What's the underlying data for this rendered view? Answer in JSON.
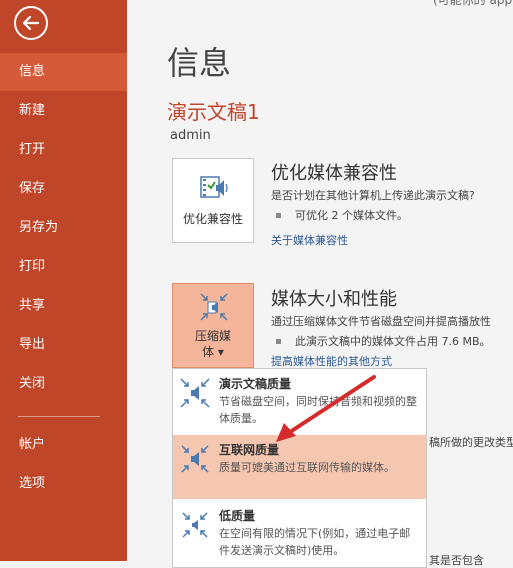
{
  "sidebar": {
    "items": [
      {
        "label": "信息"
      },
      {
        "label": "新建"
      },
      {
        "label": "打开"
      },
      {
        "label": "保存"
      },
      {
        "label": "另存为"
      },
      {
        "label": "打印"
      },
      {
        "label": "共享"
      },
      {
        "label": "导出"
      },
      {
        "label": "关闭"
      },
      {
        "label": "帐户"
      },
      {
        "label": "选项"
      }
    ]
  },
  "header": {
    "top_text": "(可能你的 app",
    "title": "信息",
    "doc_name": "演示文稿1",
    "author": "admin"
  },
  "optimize": {
    "tile_label": "优化兼容性",
    "title": "优化媒体兼容性",
    "desc": "是否计划在其他计算机上传递此演示文稿?",
    "bullet": "可优化 2 个媒体文件。",
    "link": "关于媒体兼容性"
  },
  "media": {
    "tile_label_line1": "压缩媒",
    "tile_label_line2": "体 ▾",
    "title": "媒体大小和性能",
    "desc": "通过压缩媒体文件节省磁盘空间并提高播放性",
    "bullet": "此演示文稿中的媒体文件占用 7.6 MB。",
    "link": "提高媒体性能的其他方式"
  },
  "dropdown": {
    "items": [
      {
        "title": "演示文稿质量",
        "desc": "节省磁盘空间，同时保持音频和视频的整体质量。"
      },
      {
        "title": "互联网质量",
        "desc": "质量可媲美通过互联网传输的媒体。"
      },
      {
        "title": "低质量",
        "desc": "在空间有限的情况下(例如，通过电子邮件发送演示文稿时)使用。"
      }
    ]
  },
  "behind": {
    "text1": "稿所做的更改类型,",
    "text2": "其是否包含"
  },
  "colors": {
    "sidebar_bg": "#c0462a",
    "sidebar_active": "#d45a3a",
    "accent": "#c0462a",
    "highlight": "#f6c7b0",
    "link": "#2b5797"
  }
}
